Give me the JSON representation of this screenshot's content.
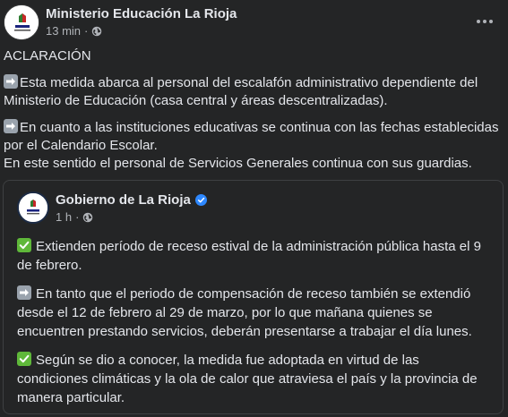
{
  "post": {
    "author": "Ministerio Educación La Rioja",
    "time": "13 min",
    "separator": "·",
    "paragraph1": "ACLARACIÓN",
    "paragraph2": "Esta medida abarca al  personal del escalafón administrativo dependiente del Ministerio de Educación (casa central y áreas descentralizadas).",
    "paragraph3_line1": "En cuanto a las instituciones educativas se continua con las fechas establecidas por el Calendario Escolar.",
    "paragraph3_line2": "En este sentido el personal de Servicios Generales continua con sus guardias.",
    "emoji_arrow": "arrow-right-emoji",
    "avatar_icon": "la-rioja-logo-icon"
  },
  "shared": {
    "author": "Gobierno de La Rioja",
    "time": "1 h",
    "separator": "·",
    "paragraph1": "Extienden período de receso estival de la administración pública hasta el 9 de febrero.",
    "paragraph2": "En tanto que el periodo de compensación de receso también se extendió desde el 12 de febrero al 29 de marzo, por lo que mañana quienes se encuentren prestando servicios, deberán presentarse a trabajar el día lunes.",
    "paragraph3": "Según se dio a conocer, la medida fue adoptada en virtud de las condiciones climáticas y la ola de calor que atraviesa el país y la provincia de manera particular.",
    "emoji_check": "check-mark-emoji",
    "verified_icon": "verified-badge-icon",
    "avatar_icon": "la-rioja-logo-icon"
  },
  "icons": {
    "more": "more-options-icon",
    "audience": "globe-icon"
  },
  "colors": {
    "background": "#242526",
    "primary_text": "#e4e6eb",
    "secondary_text": "#b0b3b8",
    "verified": "#2d88ff",
    "check_emoji": "#5fb83a",
    "arrow_emoji": "#9aa3ad",
    "card_border": "#3e4042"
  }
}
